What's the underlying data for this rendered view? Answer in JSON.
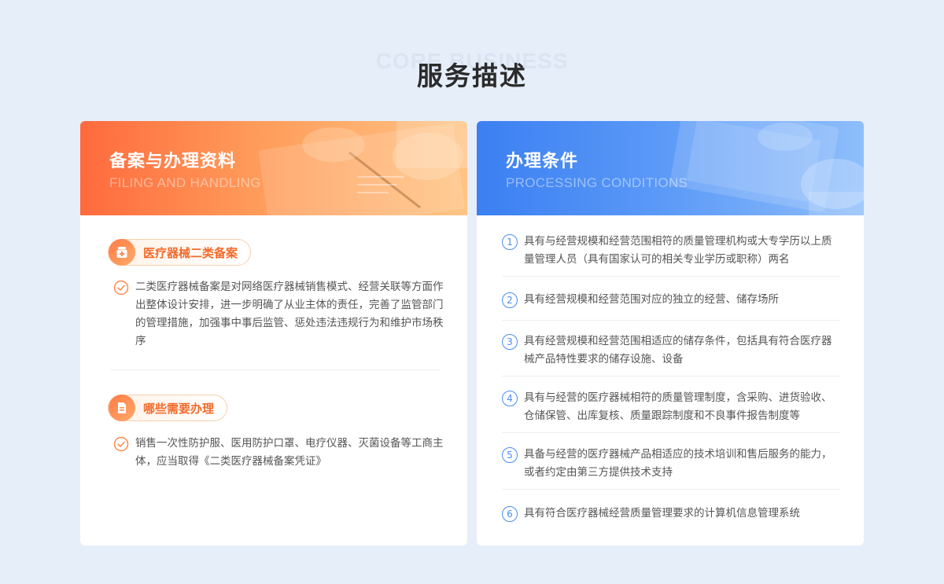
{
  "hero": {
    "watermark": "CORE BUSINESS",
    "title": "服务描述"
  },
  "left_card": {
    "title": "备案与办理资料",
    "subtitle": "FILING AND HANDLING",
    "sections": [
      {
        "icon": "medicine-box-icon",
        "label": "医疗器械二类备案",
        "text": "二类医疗器械备案是对网络医疗器械销售模式、经营关联等方面作出整体设计安排，进一步明确了从业主体的责任，完善了监管部门的管理措施，加强事中事后监管、惩处违法违规行为和维护市场秩序"
      },
      {
        "icon": "document-icon",
        "label": "哪些需要办理",
        "text": "销售一次性防护服、医用防护口罩、电疗仪器、灭菌设备等工商主体，应当取得《二类医疗器械备案凭证》"
      }
    ]
  },
  "right_card": {
    "title": "办理条件",
    "subtitle": "PROCESSING CONDITIONS",
    "conditions": [
      {
        "num": "1",
        "text": "具有与经营规模和经营范围相符的质量管理机构或大专学历以上质量管理人员（具有国家认可的相关专业学历或职称）两名"
      },
      {
        "num": "2",
        "text": "具有经营规模和经营范围对应的独立的经营、储存场所"
      },
      {
        "num": "3",
        "text": "具有经营规模和经营范围相适应的储存条件，包括具有符合医疗器械产品特性要求的储存设施、设备"
      },
      {
        "num": "4",
        "text": "具有与经营的医疗器械相符的质量管理制度，含采购、进货验收、仓储保管、出库复核、质量跟踪制度和不良事件报告制度等"
      },
      {
        "num": "5",
        "text": "具备与经营的医疗器械产品相适应的技术培训和售后服务的能力，或者约定由第三方提供技术支持"
      },
      {
        "num": "6",
        "text": "具有符合医疗器械经营质量管理要求的计算机信息管理系统"
      }
    ]
  },
  "colors": {
    "orange_accent": "#f46a2a",
    "blue_accent": "#4a8cf5",
    "background": "#e6eefa"
  }
}
